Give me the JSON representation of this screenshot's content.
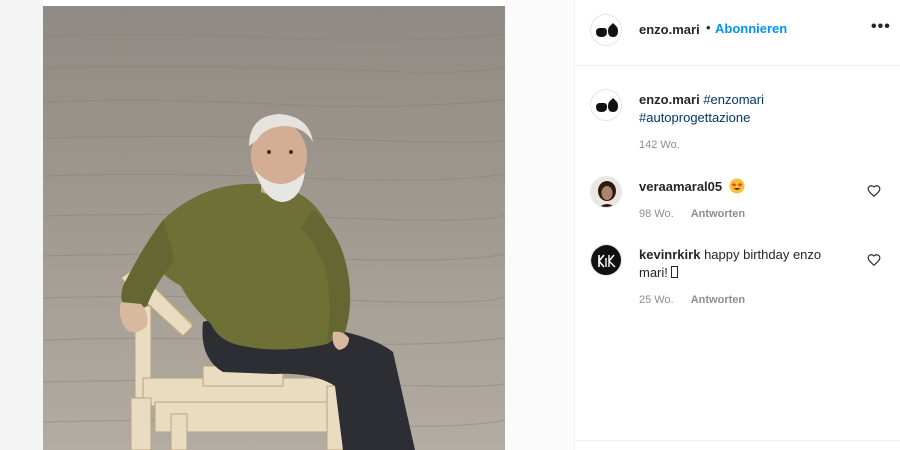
{
  "post": {
    "image_alt": "Enzo Mari sitting on a wooden autoprogettazione chair"
  },
  "header": {
    "username": "enzo.mari",
    "separator": "•",
    "follow_label": "Abonnieren",
    "more_label": "•••",
    "avatar_icon": "two-vessels-logo-icon"
  },
  "caption": {
    "username": "enzo.mari",
    "hashtags": [
      "#enzomari",
      "#autoprogettazione"
    ],
    "time": "142 Wo."
  },
  "comments": [
    {
      "username": "veraamaral05",
      "text": "",
      "emoji": "star-struck-emoji",
      "time": "98 Wo.",
      "reply_label": "Antworten"
    },
    {
      "username": "kevinrkirk",
      "text": "happy birthday enzo mari!",
      "emoji": "missing-glyph-box",
      "time": "25 Wo.",
      "reply_label": "Antworten"
    }
  ],
  "colors": {
    "accent": "#0095f6",
    "hashtag": "#00376b",
    "muted": "#8e8e8e",
    "text": "#262626"
  }
}
